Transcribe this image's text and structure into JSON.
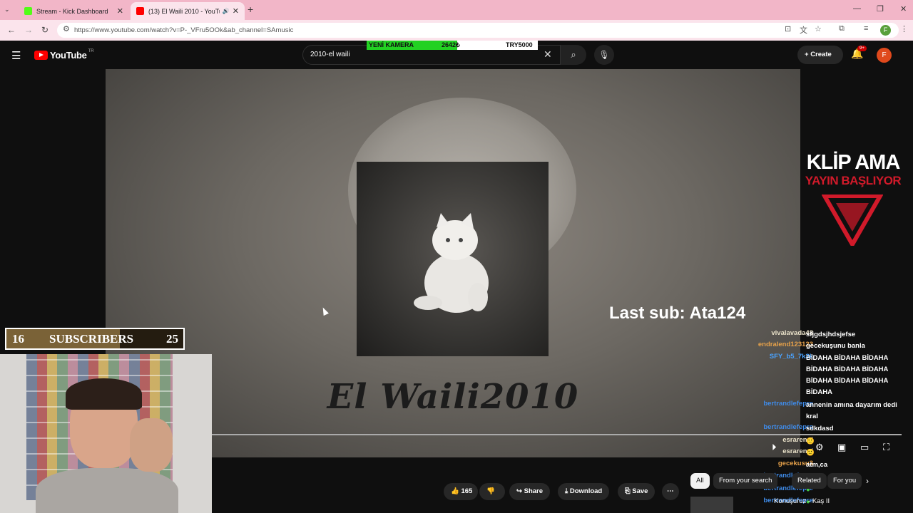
{
  "browser": {
    "tabs": [
      {
        "title": "Stream - Kick Dashboard",
        "favicon_color": "#53fc18"
      },
      {
        "title": "(13) El Waili 2010 - YouTube",
        "favicon_color": "#ff0000"
      }
    ],
    "url": "https://www.youtube.com/watch?v=P-_VFru5OOk&ab_channel=SAmusic",
    "profile_initial": "F",
    "tab_bg": "#f2b6c8"
  },
  "youtube": {
    "logo_text": "YouTube",
    "country_code": "TR",
    "search_value": "2010-el waili",
    "create_label": "Create",
    "notification_count": "9+",
    "avatar_initial": "F"
  },
  "goal_banner": {
    "label": "YENİ KAMERA",
    "current": "2642₺",
    "target": "TRY5000",
    "progress": 0.53,
    "fill_color": "#22d122"
  },
  "video": {
    "title_text": "El Waili2010"
  },
  "overlay": {
    "last_sub": "Last sub: Ata124",
    "klip": "KLİP AMA",
    "yayin": "YAYIN BAŞLIYOR",
    "accent": "#d11a2a"
  },
  "sub_goal": {
    "current": "16",
    "label": "SUBSCRIBERS",
    "target": "25",
    "progress": 0.64
  },
  "chat": [
    {
      "user": "vivalavada48",
      "text": "sfjgdsjhdsjefse",
      "color": "#e8e0c8"
    },
    {
      "user": "endralend123123",
      "text": "gecekuşunu banla",
      "color": "#e6a14a"
    },
    {
      "user": "SFY_b5_7k3k",
      "text": "BİDAHA BİDAHA BİDAHA BİDAHA BİDAHA BİDAHA BİDAHA BİDAHA BİDAHA BİDAHA",
      "color": "#4aa3ff"
    },
    {
      "user": "bertrandlefepre",
      "text": "annenin amına dayarım dedi kral",
      "color": "#3f8be8"
    },
    {
      "user": "bertrandlefepre",
      "text": "sdkdasd",
      "color": "#3f8be8"
    },
    {
      "user": "esrarengi",
      "text": "",
      "color": "#e8e0c8"
    },
    {
      "user": "esrarengi",
      "text": "",
      "color": "#e8e0c8"
    },
    {
      "user": "gecekusu3",
      "text": "atm,ca",
      "color": "#e6a14a"
    },
    {
      "user": "bertrandlefepre",
      "text": "",
      "color": "#3f8be8"
    },
    {
      "user": "bertrandlefepre",
      "text": "",
      "color": "#3f8be8"
    },
    {
      "user": "bertrandlefepre",
      "text": "",
      "color": "#3f8be8"
    }
  ],
  "chips": [
    "All",
    "From your search",
    "Related",
    "For you"
  ],
  "actions": {
    "likes": "165",
    "share": "Share",
    "download": "Download",
    "save": "Save"
  },
  "suggestion_title": "Konuşuruz - Kaş II"
}
